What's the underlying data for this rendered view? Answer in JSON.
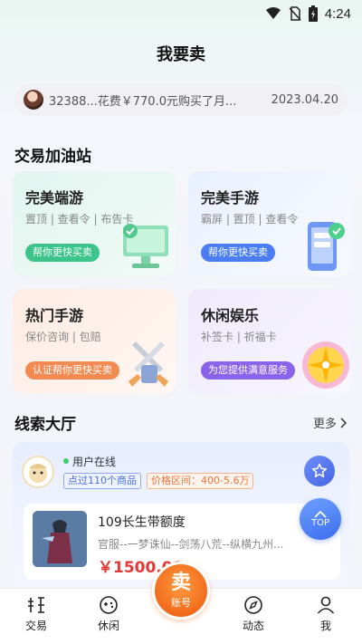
{
  "status_bar": {
    "time": "4:24",
    "icons": [
      "wifi-icon",
      "no-sim-icon",
      "battery-charging-icon"
    ]
  },
  "header": {
    "title": "我要卖"
  },
  "ticker": {
    "message": "32388...花费￥770.0元购买了月...",
    "date": "2023.04.20"
  },
  "trade_station": {
    "title": "交易加油站",
    "cards": [
      {
        "title": "完美端游",
        "subtitle": "置顶 | 查看令 | 布告卡",
        "button": "帮你更快买卖",
        "color": "#3cc48c",
        "icon": "monitor-icon"
      },
      {
        "title": "完美手游",
        "subtitle": "霸屏 | 置顶 | 查看令",
        "button": "帮你更快买卖",
        "color": "#4a7df2",
        "icon": "phone-icon"
      },
      {
        "title": "热门手游",
        "subtitle": "保价咨询 | 包赔",
        "button": "认证帮你更快买卖",
        "color": "#f28a52",
        "icon": "sword-icon"
      },
      {
        "title": "休闲娱乐",
        "subtitle": "补签卡 | 祈福卡",
        "button": "为您提供满意服务",
        "color": "#8b63ea",
        "icon": "wheel-icon"
      }
    ]
  },
  "clue_hall": {
    "title": "线索大厅",
    "more": "更多",
    "online_label": "用户在线",
    "product_count_tag": "点过110个商品",
    "price_range_tag": "价格区间：400-5.6万",
    "item": {
      "title": "109长生带额度",
      "desc": "官服--一梦诛仙--剑荡八荒--纵横九州...",
      "price": "￥1500.00"
    },
    "top_label": "TOP"
  },
  "bottom_nav": {
    "items": [
      {
        "label": "交易",
        "icon": "trade-icon"
      },
      {
        "label": "休闲",
        "icon": "gamepad-icon"
      },
      {
        "label": "动态",
        "icon": "compass-icon"
      },
      {
        "label": "我",
        "icon": "user-icon"
      }
    ],
    "sell": {
      "big": "卖",
      "small": "账号"
    }
  }
}
